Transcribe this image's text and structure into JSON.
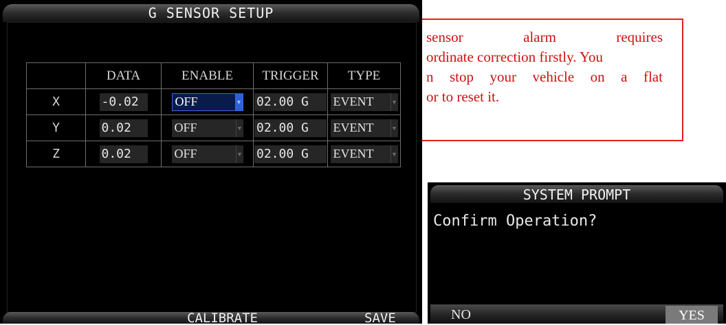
{
  "main": {
    "title": "G SENSOR SETUP",
    "columns": [
      "",
      "DATA",
      "ENABLE",
      "TRIGGER",
      "TYPE"
    ],
    "rows": [
      {
        "axis": "X",
        "data": "-0.02",
        "enable": "OFF",
        "trigger": "02.00 G",
        "type": "EVENT"
      },
      {
        "axis": "Y",
        "data": "0.02",
        "enable": "OFF",
        "trigger": "02.00 G",
        "type": "EVENT"
      },
      {
        "axis": "Z",
        "data": "0.02",
        "enable": "OFF",
        "trigger": "02.00 G",
        "type": "EVENT"
      }
    ],
    "calibrate_label": "CALIBRATE",
    "save_label": "SAVE"
  },
  "note": {
    "line1": [
      "sensor",
      "alarm",
      "requires"
    ],
    "line2": "ordinate correction firstly. You",
    "line3": [
      "n",
      "stop",
      "your",
      "vehicle",
      "on",
      "a",
      "flat"
    ],
    "line4": "or to reset it."
  },
  "prompt": {
    "title": "SYSTEM PROMPT",
    "message": "Confirm Operation?",
    "no_label": "NO",
    "yes_label": "YES"
  },
  "colors": {
    "note_red": "#cc1111",
    "focus_blue": "#2d5fd8"
  }
}
